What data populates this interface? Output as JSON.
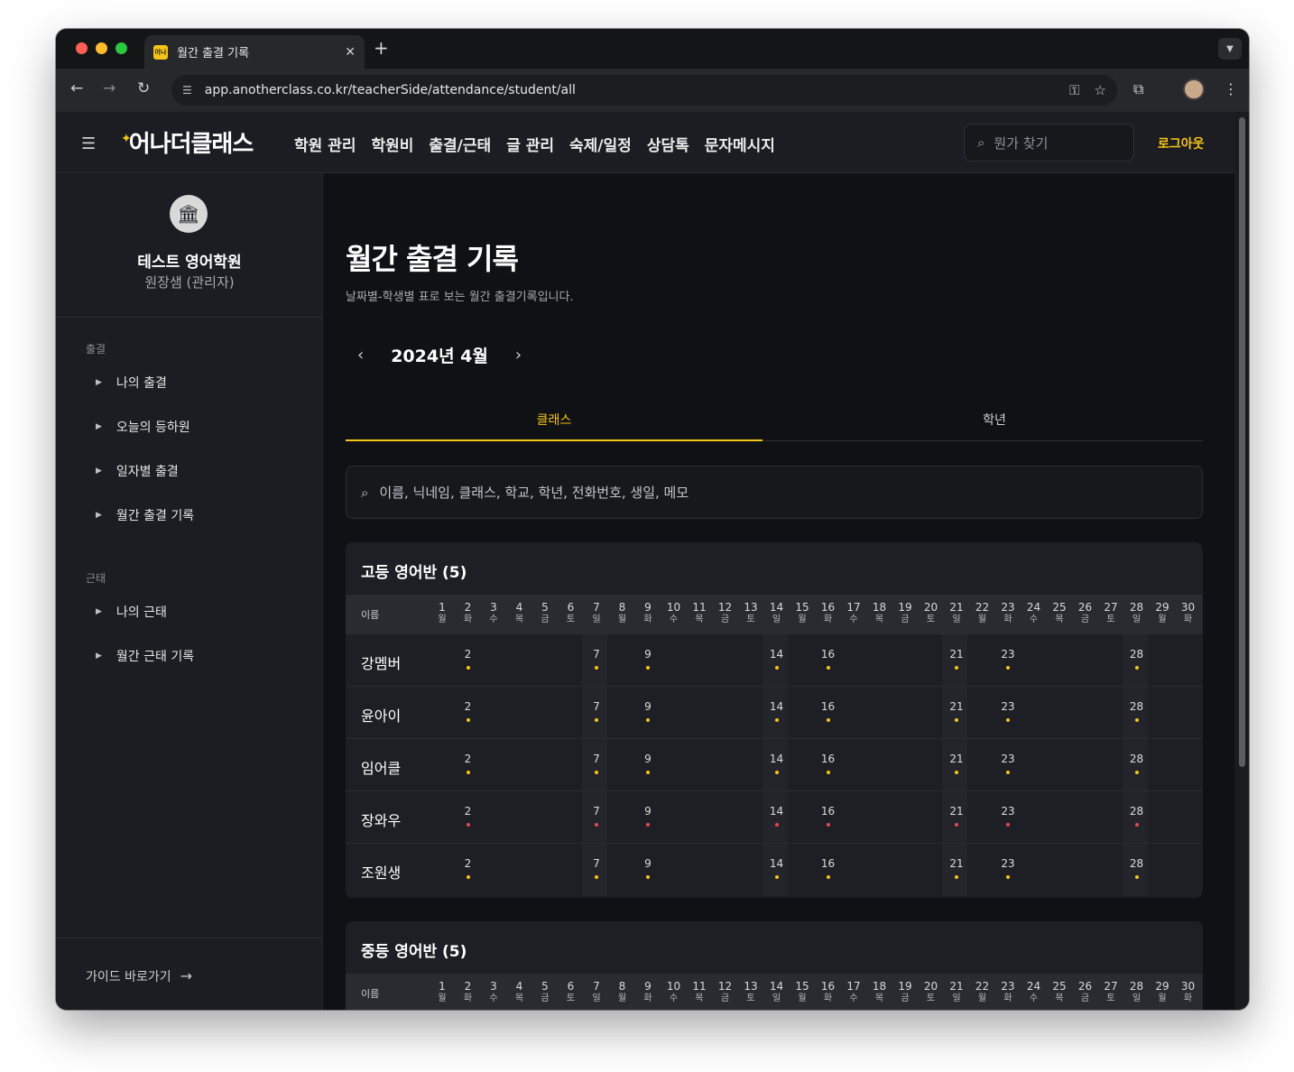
{
  "browser": {
    "tab_title": "월간 출결 기록",
    "favicon_text": "어나",
    "url": "app.anotherclass.co.kr/teacherSide/attendance/student/all",
    "new_tab": "+",
    "tab_close": "✕"
  },
  "topnav": {
    "logo": "어나더클래스",
    "menu": [
      "학원 관리",
      "학원비",
      "출결/근태",
      "글 관리",
      "숙제/일정",
      "상담톡",
      "문자메시지"
    ],
    "search_placeholder": "뭔가 찾기",
    "logout": "로그아웃"
  },
  "sidebar": {
    "org_name": "테스트 영어학원",
    "org_role": "원장샘 (관리자)",
    "sections": [
      {
        "title": "출결",
        "items": [
          "나의 출결",
          "오늘의 등하원",
          "일자별 출결",
          "월간 출결 기록"
        ]
      },
      {
        "title": "근태",
        "items": [
          "나의 근태",
          "월간 근태 기록"
        ]
      }
    ],
    "guide": "가이드 바로가기"
  },
  "main": {
    "title": "월간 출결 기록",
    "subtitle": "날짜별-학생별 표로 보는 월간 출결기록입니다.",
    "month": "2024년 4월",
    "tabs": [
      "클래스",
      "학년"
    ],
    "filter_placeholder": "이름, 닉네임, 클래스, 학교, 학년, 전화번호, 생일, 메모",
    "name_header": "이름",
    "weekdays": [
      "월",
      "화",
      "수",
      "목",
      "금",
      "토",
      "일",
      "월",
      "화",
      "수",
      "목",
      "금",
      "토",
      "일",
      "월",
      "화",
      "수",
      "목",
      "금",
      "토",
      "일",
      "월",
      "화",
      "수",
      "목",
      "금",
      "토",
      "일",
      "월",
      "화"
    ],
    "attendance_days": [
      2,
      7,
      9,
      14,
      16,
      21,
      23,
      28
    ],
    "shaded_days": [
      7,
      14,
      21,
      28
    ],
    "colors": {
      "accent": "#f5c518",
      "present_dot": "#f5c518",
      "absent_dot": "#e5484d"
    },
    "classes": [
      {
        "title": "고등 영어반 (5)",
        "students": [
          {
            "name": "강멤버",
            "status": "present"
          },
          {
            "name": "윤아이",
            "status": "present"
          },
          {
            "name": "임어클",
            "status": "present"
          },
          {
            "name": "장와우",
            "status": "absent"
          },
          {
            "name": "조원생",
            "status": "present"
          }
        ]
      },
      {
        "title": "중등 영어반 (5)",
        "students": []
      }
    ]
  }
}
